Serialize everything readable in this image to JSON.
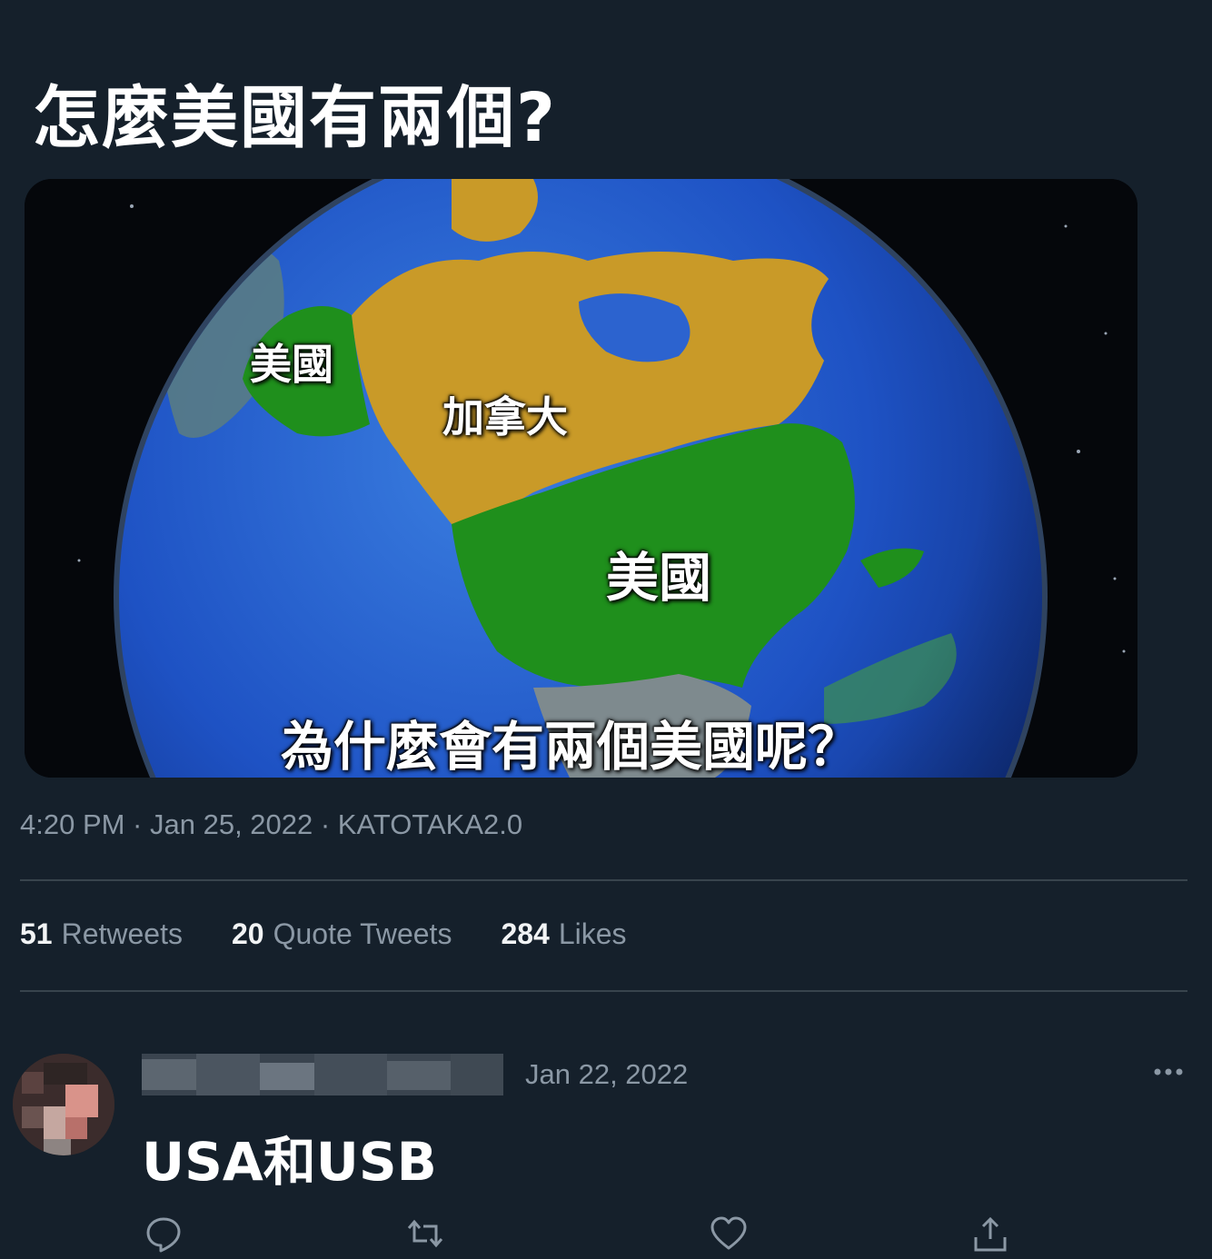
{
  "tweet": {
    "text": "怎麼美國有兩個?",
    "meta": "4:20 PM · Jan 25, 2022 · KATOTAKA2.0",
    "image": {
      "label_alaska": "美國",
      "label_canada": "加拿大",
      "label_usa": "美國",
      "caption": "為什麼會有兩個美國呢？",
      "colors": {
        "usa": "#1f8f1c",
        "canada": "#c99a28",
        "ocean": "#1f4fc0",
        "space": "#05070b"
      }
    },
    "stats": [
      {
        "count": "51",
        "label": "Retweets"
      },
      {
        "count": "20",
        "label": "Quote Tweets"
      },
      {
        "count": "284",
        "label": "Likes"
      }
    ]
  },
  "reply": {
    "date": "Jan 22, 2022",
    "text": "USA和USB",
    "icons": [
      "reply-icon",
      "retweet-icon",
      "like-icon",
      "share-icon",
      "more-icon"
    ]
  },
  "theme": {
    "background": "#15202b",
    "secondary_text": "#8b98a5",
    "divider": "#38444d"
  }
}
